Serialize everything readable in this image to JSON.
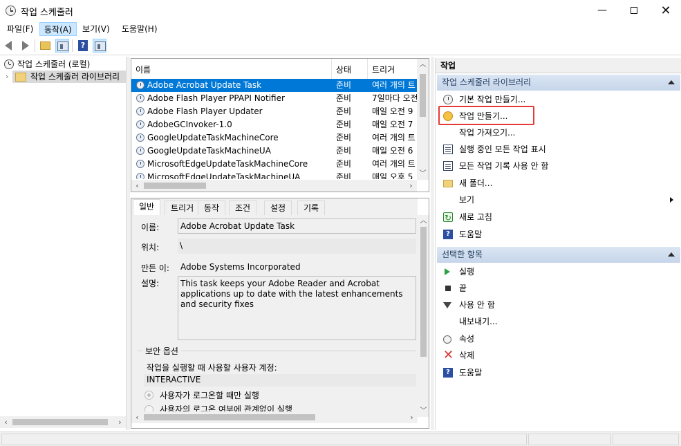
{
  "window": {
    "title": "작업 스케줄러",
    "minimize_glyph": "—",
    "close_glyph": "✕"
  },
  "menu": {
    "file": "파일(F)",
    "action": "동작(A)",
    "view": "보기(V)",
    "help": "도움말(H)"
  },
  "toolbar": {
    "back_icon": "back-arrow",
    "forward_icon": "forward-arrow",
    "help_glyph": "?"
  },
  "tree": {
    "root": "작업 스케줄러 (로컬)",
    "library": "작업 스케줄러 라이브러리",
    "expander": "›"
  },
  "task_list": {
    "columns": {
      "name": "이름",
      "status": "상태",
      "trigger": "트리거"
    },
    "rows": [
      {
        "name": "Adobe Acrobat Update Task",
        "status": "준비",
        "trigger": "여러 개의 트"
      },
      {
        "name": "Adobe Flash Player PPAPI Notifier",
        "status": "준비",
        "trigger": "7일마다 오전"
      },
      {
        "name": "Adobe Flash Player Updater",
        "status": "준비",
        "trigger": "매일 오전 9"
      },
      {
        "name": "AdobeGCInvoker-1.0",
        "status": "준비",
        "trigger": "매일 오전 7"
      },
      {
        "name": "GoogleUpdateTaskMachineCore",
        "status": "준비",
        "trigger": "여러 개의 트"
      },
      {
        "name": "GoogleUpdateTaskMachineUA",
        "status": "준비",
        "trigger": "매일 오전 6"
      },
      {
        "name": "MicrosoftEdgeUpdateTaskMachineCore",
        "status": "준비",
        "trigger": "여러 개의 트"
      },
      {
        "name": "MicrosoftEdgeUpdateTaskMachineUA",
        "status": "준비",
        "trigger": "매일 오후 5"
      }
    ]
  },
  "details": {
    "tabs": [
      "일반",
      "트리거",
      "동작",
      "조건",
      "설정",
      "기록"
    ],
    "name_label": "이름:",
    "name_value": "Adobe Acrobat Update Task",
    "location_label": "위치:",
    "location_value": "\\",
    "author_label": "만든 이:",
    "author_value": "Adobe Systems Incorporated",
    "description_label": "설명:",
    "description_value": "This task keeps your Adobe Reader and Acrobat applications up to date with the latest enhancements and security fixes",
    "security_group": "보안 옵션",
    "run_as_label": "작업을 실행할 때 사용할 사용자 계정:",
    "run_as_value": "INTERACTIVE",
    "radio1": "사용자가 로그온할 때만 실행",
    "radio2": "사용자의 로그온 여부에 관계없이 실행"
  },
  "actions": {
    "header": "작업",
    "section1": "작업 스케줄러 라이브러리",
    "items1": [
      {
        "label": "기본 작업 만들기...",
        "icon": "basic-task-icon"
      },
      {
        "label": "작업 만들기...",
        "icon": "create-task-icon"
      },
      {
        "label": "작업 가져오기...",
        "icon": ""
      },
      {
        "label": "실행 중인 모든 작업 표시",
        "icon": "running-tasks-icon"
      },
      {
        "label": "모든 작업 기록 사용 안 함",
        "icon": "history-icon"
      },
      {
        "label": "새 폴더...",
        "icon": "folder-icon"
      },
      {
        "label": "보기",
        "icon": ""
      },
      {
        "label": "새로 고침",
        "icon": "refresh-icon"
      },
      {
        "label": "도움말",
        "icon": "help-icon"
      }
    ],
    "section2": "선택한 항목",
    "items2": [
      {
        "label": "실행",
        "icon": "run-icon"
      },
      {
        "label": "끝",
        "icon": "stop-icon"
      },
      {
        "label": "사용 안 함",
        "icon": "disable-icon"
      },
      {
        "label": "내보내기...",
        "icon": ""
      },
      {
        "label": "속성",
        "icon": "properties-icon"
      },
      {
        "label": "삭제",
        "icon": "delete-icon"
      },
      {
        "label": "도움말",
        "icon": "help-icon"
      }
    ]
  },
  "colors": {
    "selection": "#0078d7",
    "highlight": "#e53935",
    "section_bar": "#c6d5ea"
  }
}
